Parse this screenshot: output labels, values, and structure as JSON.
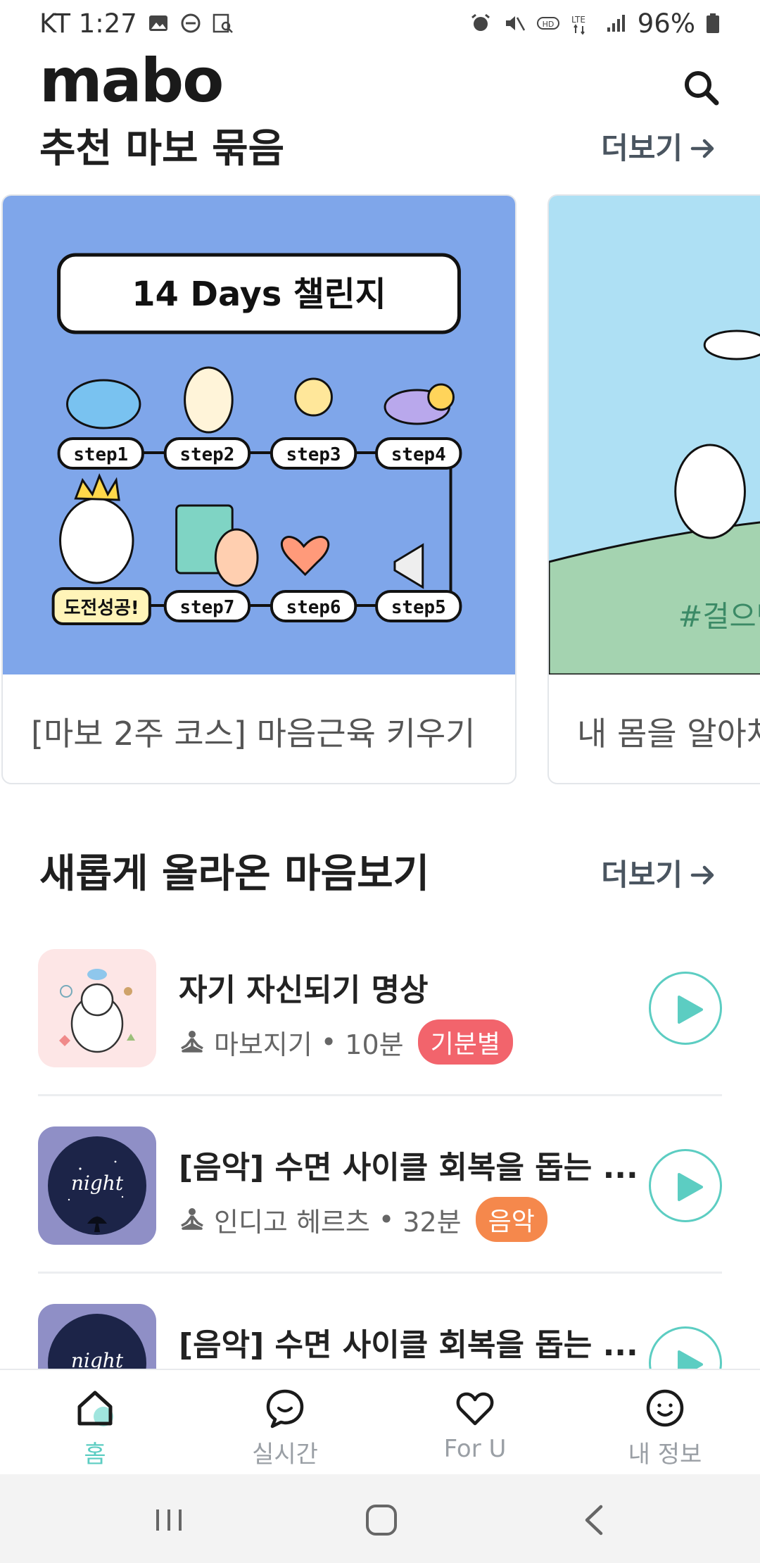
{
  "status_bar": {
    "carrier_time": "KT 1:27",
    "battery": "96%"
  },
  "header": {
    "logo": "mabo"
  },
  "recommended": {
    "title": "추천 마보 묶음",
    "more": "더보기",
    "cards": [
      {
        "caption": "[마보 2주 코스] 마음근육 키우기",
        "banner_title": "14 Days 챌린지",
        "steps": [
          "step1",
          "step2",
          "step3",
          "step4",
          "도전성공!",
          "step7",
          "step6",
          "step5"
        ],
        "bg_color": "#7fa6ea"
      },
      {
        "caption": "내 몸을 알아차",
        "hashtag": "#걸으면",
        "bg_color": "#aee0f4"
      }
    ]
  },
  "new_uploads": {
    "title": "새롭게 올라온 마음보기",
    "more": "더보기",
    "items": [
      {
        "title": "자기 자신되기 명상",
        "author": "마보지기",
        "duration": "10분",
        "tag": "기분별",
        "tag_color": "#f2646c",
        "thumb_bg": "#fde6e6"
      },
      {
        "title": "[음악] 수면 사이클 회복을 돕는 ...",
        "author": "인디고 헤르츠",
        "duration": "32분",
        "tag": "음악",
        "tag_color": "#f5884c",
        "thumb_bg": "#8f8fc6",
        "thumb_text": "night"
      },
      {
        "title": "[음악] 수면 사이클 회복을 돕는 ...",
        "thumb_bg": "#8f8fc6",
        "thumb_text": "night"
      }
    ],
    "separator": "•"
  },
  "tabs": [
    {
      "label": "홈",
      "icon": "home-icon"
    },
    {
      "label": "실시간",
      "icon": "chat-icon"
    },
    {
      "label": "For U",
      "icon": "heart-icon"
    },
    {
      "label": "내 정보",
      "icon": "profile-icon"
    }
  ],
  "accent_color": "#5ccdc2"
}
